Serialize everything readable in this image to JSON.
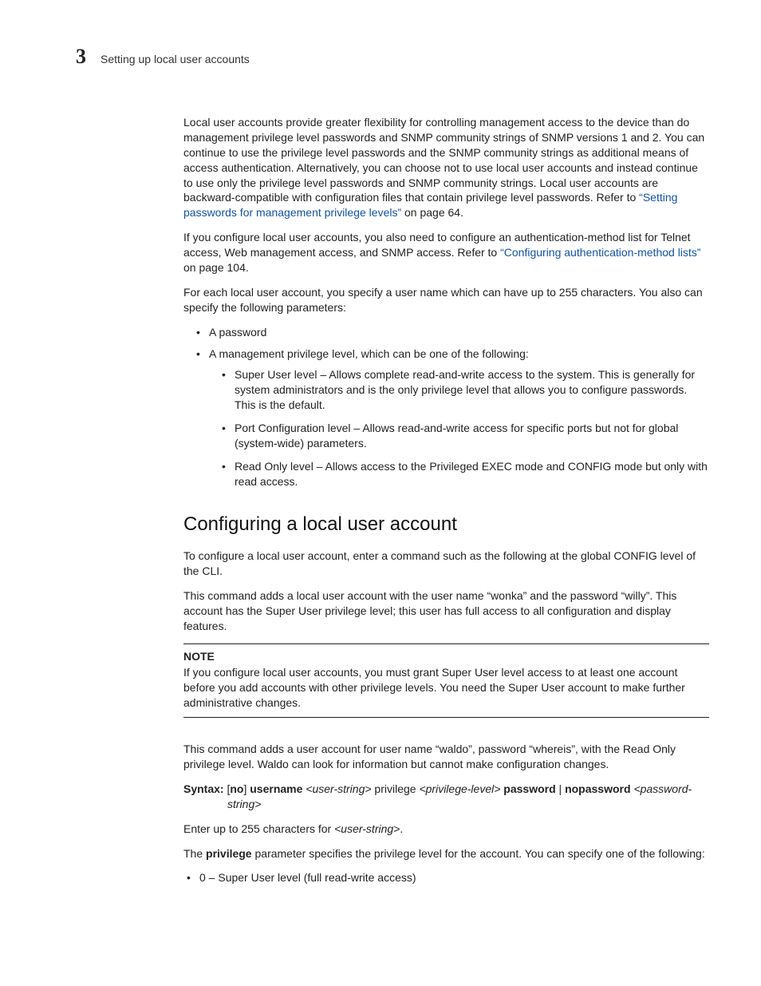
{
  "header": {
    "chapter_number": "3",
    "running_title": "Setting up local user accounts"
  },
  "p1": {
    "pre": "Local user accounts provide greater flexibility for controlling management access to the device than do management privilege level passwords and SNMP community strings of SNMP versions 1 and 2. You can continue to use the privilege level passwords and the SNMP community strings as additional means of access authentication. Alternatively, you can choose not to use local user accounts and instead continue to use only the privilege level passwords and SNMP community strings. Local user accounts are backward-compatible with configuration files that contain privilege level passwords. Refer to ",
    "link": "“Setting passwords for management privilege levels”",
    "post": " on page 64."
  },
  "p2": {
    "pre": "If you configure local user accounts, you also need to configure an authentication-method list for Telnet access, Web management access, and SNMP access. Refer to ",
    "link": "“Configuring authentication-method lists”",
    "post": " on page 104."
  },
  "p3": "For each local user account, you specify a user name which can have up to 255 characters.  You also can specify the following parameters:",
  "list1": {
    "item1": "A password",
    "item2": "A management privilege level, which can be one of the following:",
    "sub": {
      "s1": "Super User level – Allows complete read-and-write access to the system.  This is generally for system administrators and is the only privilege level that allows you to configure passwords.  This is the default.",
      "s2": "Port Configuration level – Allows read-and-write access for specific ports but not for global (system-wide) parameters.",
      "s3": "Read Only level – Allows access to the Privileged EXEC mode and CONFIG mode but only with read access."
    }
  },
  "heading": "Configuring a local user account",
  "p4": "To configure a local user account, enter a command such as the following at the global CONFIG level of the CLI.",
  "p5": "This command adds a local user account with the user name “wonka” and the password “willy”.  This account has the Super User privilege level; this user has full access to all configuration and display features.",
  "note": {
    "label": "NOTE",
    "body": "If you configure local user accounts, you must grant Super User level access to at least one account before you add accounts with other privilege levels.  You need the Super User account to make further administrative changes."
  },
  "p6": "This command adds a user account for user name “waldo”, password “whereis”, with the Read Only privilege level.  Waldo can look for information but cannot make configuration changes.",
  "syntax": {
    "label": "Syntax:",
    "t1": "  [",
    "no": "no",
    "t2": "] ",
    "username": "username",
    "t3": " ",
    "userstr": "<user-string>",
    "t4": " privilege ",
    "priv": "<privilege-level>",
    "t5": " ",
    "password": "password",
    "bar": " | ",
    "nopassword": "nopassword",
    "t6": " ",
    "pwstr": "<password-string>"
  },
  "p7": {
    "pre": "Enter up to 255 characters for ",
    "i": "<user-string>",
    "post": "."
  },
  "p8": {
    "pre": "The ",
    "b": "privilege",
    "post": " parameter specifies the privilege level for the account.  You can specify one of the following:"
  },
  "list2": {
    "item1": "0 – Super User level (full read-write access)"
  }
}
